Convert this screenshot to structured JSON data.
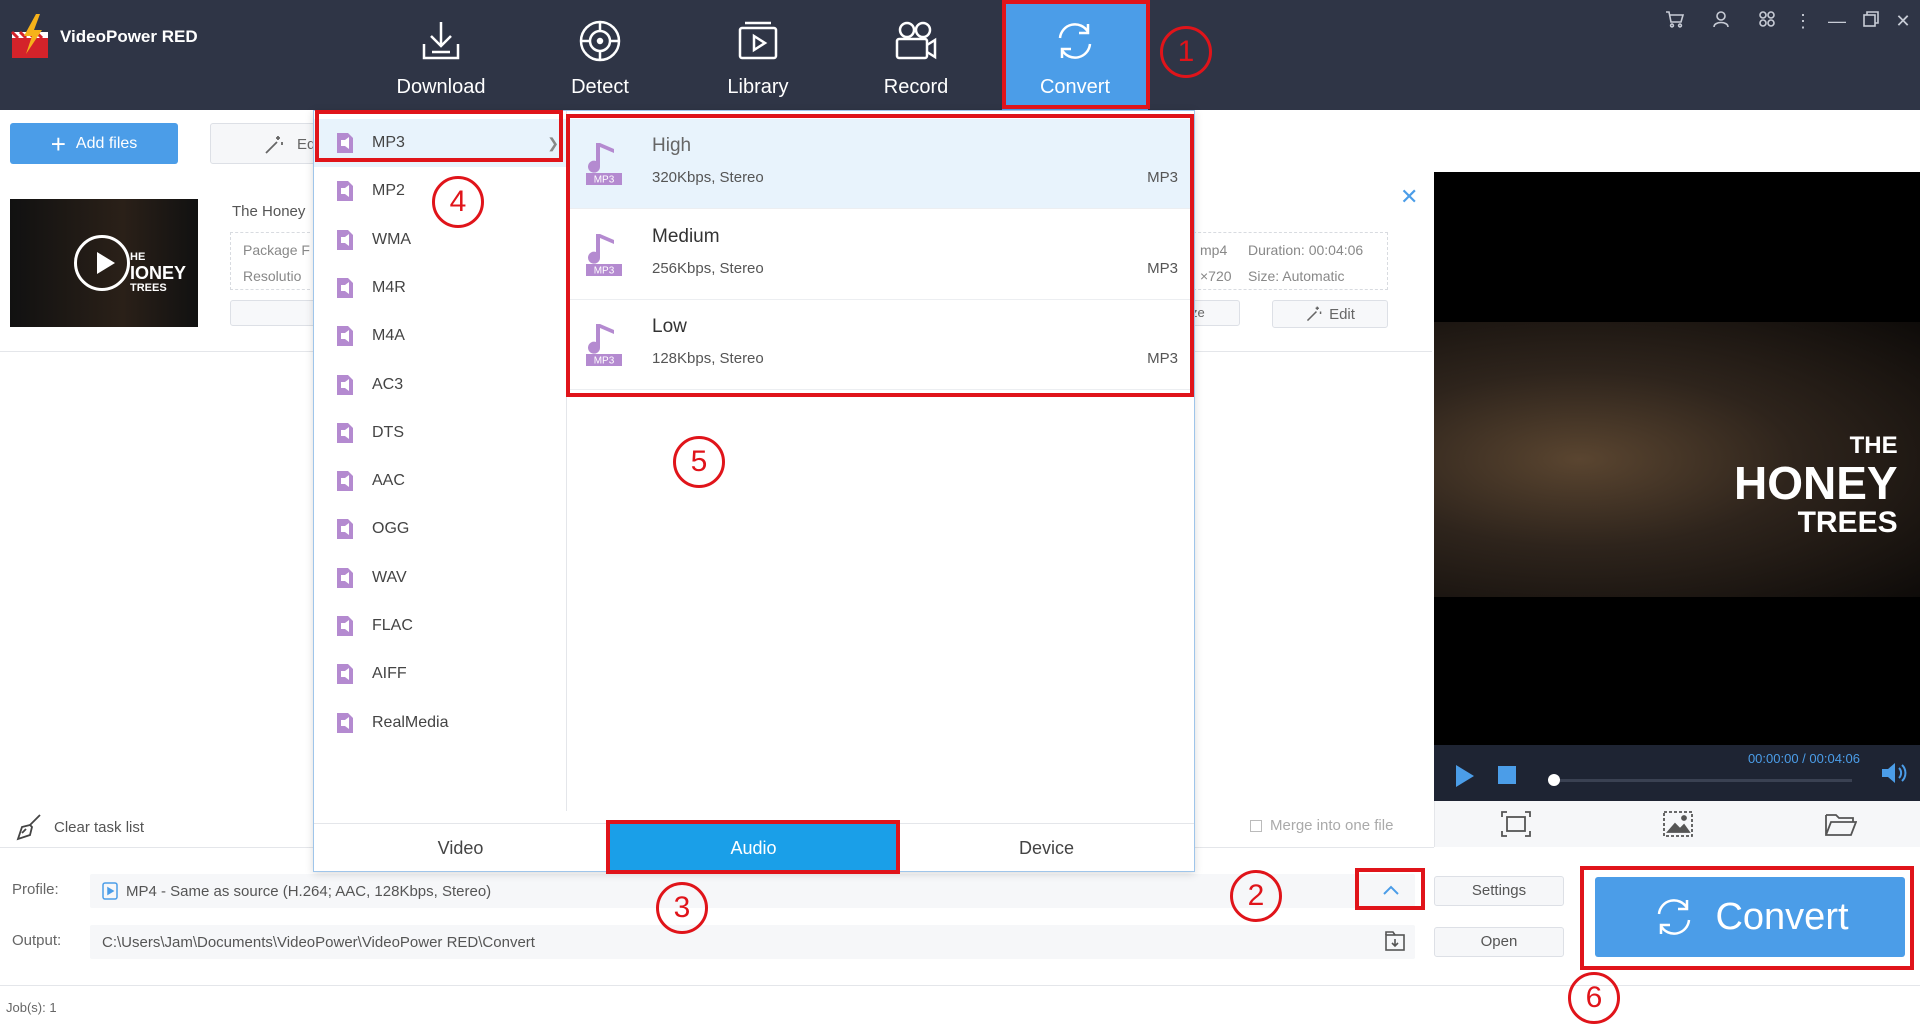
{
  "app": {
    "title": "VideoPower RED",
    "brand_color": "#4b9de8",
    "header_color": "#2f3546",
    "annotation_color": "#e0141a"
  },
  "nav": [
    {
      "label": "Download",
      "icon": "download-icon"
    },
    {
      "label": "Detect",
      "icon": "detect-icon"
    },
    {
      "label": "Library",
      "icon": "library-icon"
    },
    {
      "label": "Record",
      "icon": "record-icon"
    },
    {
      "label": "Convert",
      "icon": "convert-icon",
      "active": true
    }
  ],
  "toolbar": {
    "add_files": "Add files",
    "edit": "Ed"
  },
  "task": {
    "title": "The Honey",
    "info_left": [
      "Package F",
      "Resolutio"
    ],
    "info_right_col1": [
      "mp4",
      "×720"
    ],
    "duration": "Duration: 00:04:06",
    "size": "Size: Automatic",
    "mid_btn": "ze",
    "edit": "Edit",
    "thumb_text": [
      "HE",
      "IONEY",
      "TREES"
    ]
  },
  "preview": {
    "overlay_text": [
      "THE",
      "HONEY",
      "TREES"
    ],
    "time": "00:00:00 / 00:04:06",
    "progress": 0
  },
  "formats": [
    "MP3",
    "MP2",
    "WMA",
    "M4R",
    "M4A",
    "AC3",
    "DTS",
    "AAC",
    "OGG",
    "WAV",
    "FLAC",
    "AIFF",
    "RealMedia"
  ],
  "qualities": [
    {
      "name": "High",
      "detail": "320Kbps, Stereo",
      "format": "MP3",
      "badge": "MP3",
      "selected": true
    },
    {
      "name": "Medium",
      "detail": "256Kbps, Stereo",
      "format": "MP3",
      "badge": "MP3"
    },
    {
      "name": "Low",
      "detail": "128Kbps, Stereo",
      "format": "MP3",
      "badge": "MP3"
    }
  ],
  "popup_tabs": {
    "video": "Video",
    "audio": "Audio",
    "device": "Device"
  },
  "bottom": {
    "clear_task": "Clear task list",
    "merge": "Merge into one file",
    "profile_label": "Profile:",
    "profile_value": "MP4 - Same as source (H.264; AAC, 128Kbps, Stereo)",
    "output_label": "Output:",
    "output_value": "C:\\Users\\Jam\\Documents\\VideoPower\\VideoPower RED\\Convert",
    "settings": "Settings",
    "open": "Open",
    "convert": "Convert",
    "jobs": "Job(s): 1"
  },
  "steps": [
    "1",
    "2",
    "3",
    "4",
    "5",
    "6"
  ]
}
